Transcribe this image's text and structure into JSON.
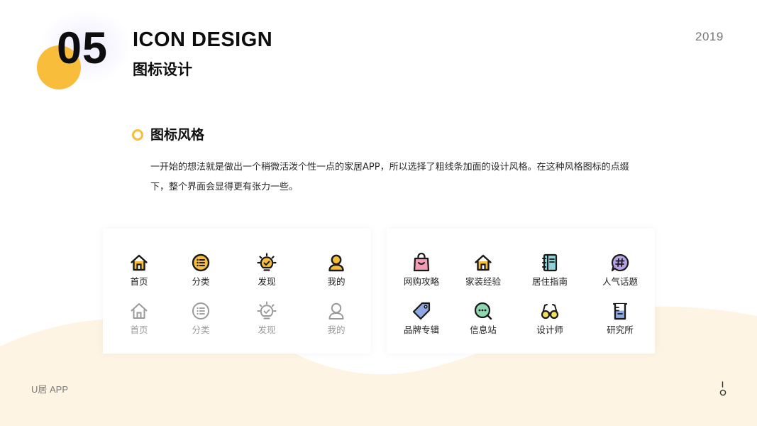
{
  "colors": {
    "accent": "#F8BD3B",
    "peach_bg": "#FDF4E4",
    "dark": "#111111",
    "muted": "#9A9A9A",
    "pink": "#F39AB5",
    "blue": "#8FA8E4",
    "teal": "#8FD3D8",
    "purple": "#B7A2E6",
    "green": "#8ED7B1"
  },
  "header": {
    "number": "05",
    "title_en": "ICON DESIGN",
    "title_cn": "图标设计",
    "year": "2019"
  },
  "section": {
    "title": "图标风格",
    "paragraph": "一开始的想法就是做出一个稍微活泼个性一点的家居APP，所以选择了粗线条加面的设计风格。在这种风格图标的点缀下，整个界面会显得更有张力一些。"
  },
  "nav_icons": {
    "active": [
      {
        "label": "首页",
        "icon": "home-icon"
      },
      {
        "label": "分类",
        "icon": "list-icon"
      },
      {
        "label": "发现",
        "icon": "lightbulb-icon"
      },
      {
        "label": "我的",
        "icon": "user-icon"
      }
    ],
    "inactive": [
      {
        "label": "首页",
        "icon": "home-icon"
      },
      {
        "label": "分类",
        "icon": "list-icon"
      },
      {
        "label": "发现",
        "icon": "lightbulb-icon"
      },
      {
        "label": "我的",
        "icon": "user-icon"
      }
    ]
  },
  "feature_icons": [
    {
      "label": "网购攻略",
      "icon": "shopping-bag-icon"
    },
    {
      "label": "家装经验",
      "icon": "house-icon"
    },
    {
      "label": "居住指南",
      "icon": "notebook-icon"
    },
    {
      "label": "人气话题",
      "icon": "hashtag-bubble-icon"
    },
    {
      "label": "品牌专辑",
      "icon": "tag-icon"
    },
    {
      "label": "信息站",
      "icon": "chat-search-icon"
    },
    {
      "label": "设计师",
      "icon": "glasses-icon"
    },
    {
      "label": "研究所",
      "icon": "beaker-icon"
    }
  ],
  "footer": {
    "brand": "U居 APP"
  }
}
